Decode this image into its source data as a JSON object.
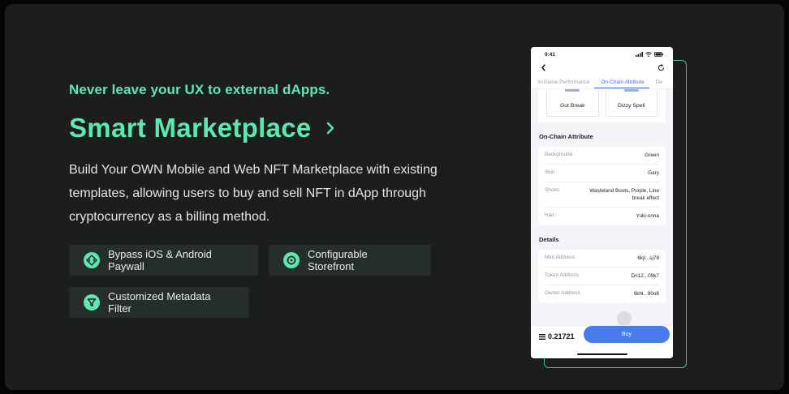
{
  "hero": {
    "eyebrow": "Never leave your UX to external dApps.",
    "title": "Smart Marketplace",
    "description": "Build Your OWN Mobile and Web NFT Marketplace with existing templates, allowing users to buy and sell NFT in dApp through cryptocurrency as a billing method."
  },
  "features": [
    {
      "label": "Bypass iOS & Android Paywall",
      "icon": "eye-code-icon"
    },
    {
      "label": "Configurable Storefront",
      "icon": "storefront-icon"
    },
    {
      "label": "Customized Metadata Filter",
      "icon": "filter-icon"
    }
  ],
  "colors": {
    "accent": "#5ee8b0",
    "card_bg": "#1c1d1d",
    "feature_bg": "#252e2b",
    "buy_button": "#4a7bec"
  },
  "phone": {
    "time": "9:41",
    "tabs": [
      "In-Game Performance",
      "On-Chain Attribute",
      "De"
    ],
    "active_tab": "On-Chain Attribute",
    "chips": [
      "Gut Break",
      "Dizzy Spell"
    ],
    "onchain_title": "On-Chain Attribute",
    "attributes": [
      {
        "key": "Background",
        "value": "Green"
      },
      {
        "key": "Skin",
        "value": "Gary"
      },
      {
        "key": "Shoes",
        "value": "Wasteland Boots, Purple, Line break effect"
      },
      {
        "key": "Hair",
        "value": "Yuki-onna"
      }
    ],
    "details_title": "Details",
    "details": [
      {
        "key": "Mint Address",
        "value": "6kjl...sj78"
      },
      {
        "key": "Token Address",
        "value": "Dri12...09k7"
      },
      {
        "key": "Owner Address",
        "value": "9khl...90o8"
      }
    ],
    "price": "0.21721",
    "buy_label": "Buy"
  }
}
